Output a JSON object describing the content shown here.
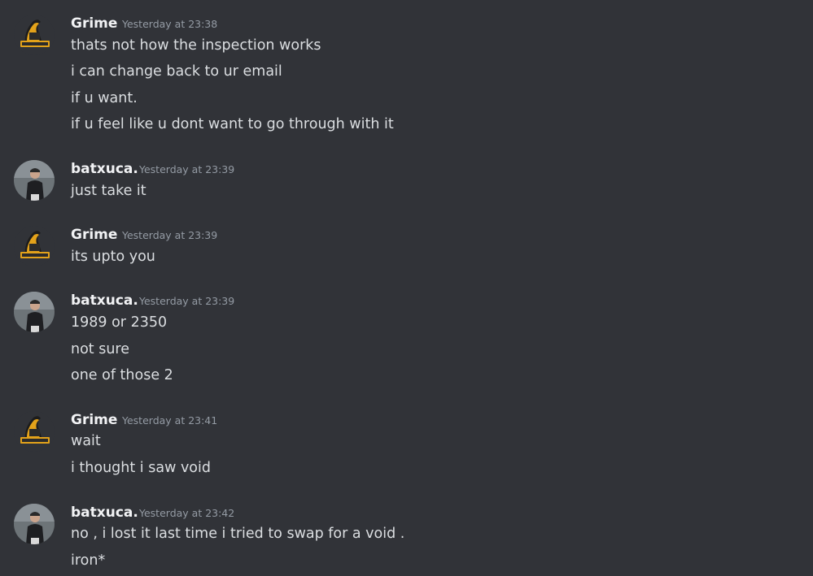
{
  "messages": [
    {
      "author": "Grime",
      "avatar": "grime-logo-avatar",
      "timestamp": "Yesterday at 23:38",
      "lines": [
        "thats not how the inspection works",
        "i can change back to ur email",
        "if u want.",
        "if u feel like u dont want to go through with it"
      ]
    },
    {
      "author": "batxuca.",
      "avatar": "batxuca-photo-avatar",
      "timestamp": "Yesterday at 23:39",
      "lines": [
        "just take it"
      ]
    },
    {
      "author": "Grime",
      "avatar": "grime-logo-avatar",
      "timestamp": "Yesterday at 23:39",
      "lines": [
        "its upto you"
      ]
    },
    {
      "author": "batxuca.",
      "avatar": "batxuca-photo-avatar",
      "timestamp": "Yesterday at 23:39",
      "lines": [
        "1989 or 2350",
        "not sure",
        "one of those 2"
      ]
    },
    {
      "author": "Grime",
      "avatar": "grime-logo-avatar",
      "timestamp": "Yesterday at 23:41",
      "lines": [
        "wait",
        "i thought i saw void"
      ]
    },
    {
      "author": "batxuca.",
      "avatar": "batxuca-photo-avatar",
      "timestamp": "Yesterday at 23:42",
      "lines": [
        "no , i lost it last time i tried to swap for a void .",
        "iron*"
      ]
    }
  ],
  "colors": {
    "background": "#313338",
    "author": "#f2f3f5",
    "timestamp": "#949ba4",
    "message_text": "#dbdee1",
    "grime_logo_gold": "#e3a21a"
  }
}
